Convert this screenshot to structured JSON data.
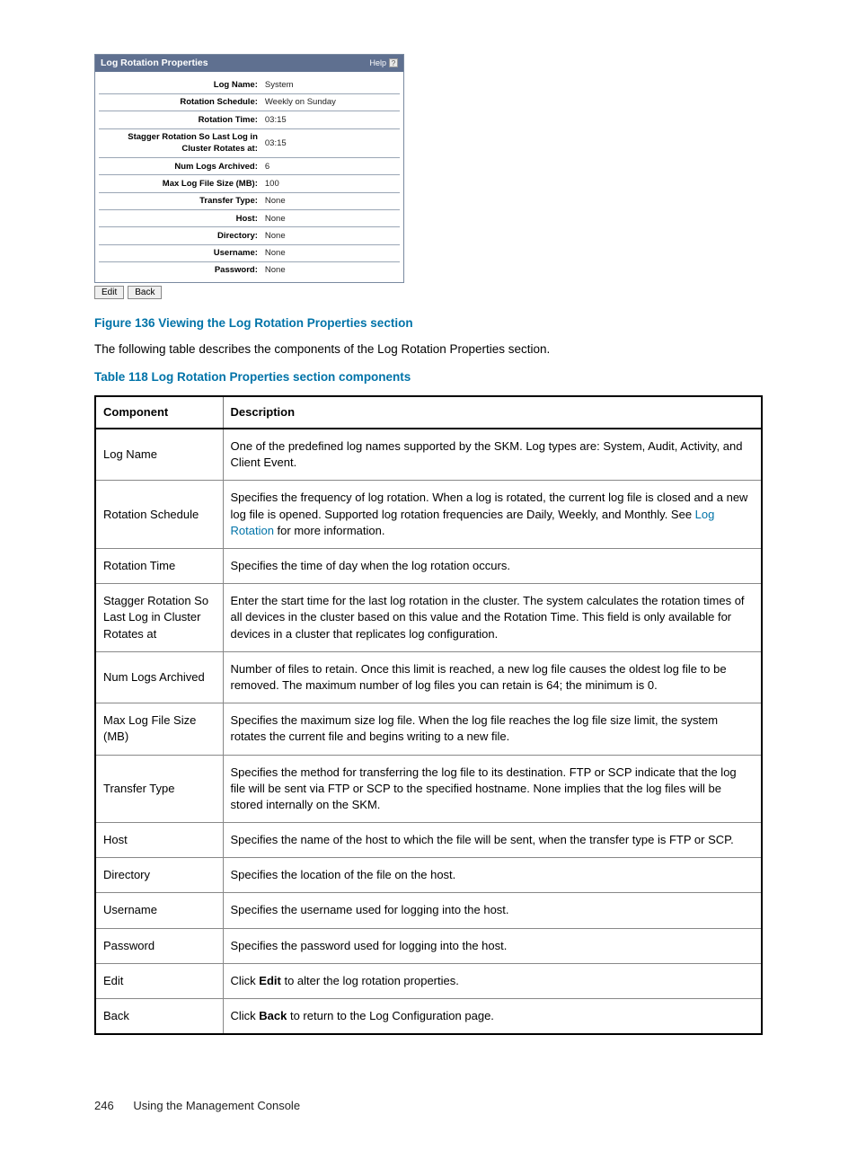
{
  "panel": {
    "title": "Log Rotation Properties",
    "help_label": "Help",
    "help_icon": "?",
    "rows": [
      {
        "label": "Log Name:",
        "value": "System"
      },
      {
        "label": "Rotation Schedule:",
        "value": "Weekly on Sunday"
      },
      {
        "label": "Rotation Time:",
        "value": "03:15"
      },
      {
        "label": "Stagger Rotation So Last Log in Cluster Rotates at:",
        "value": "03:15"
      },
      {
        "label": "Num Logs Archived:",
        "value": "6"
      },
      {
        "label": "Max Log File Size (MB):",
        "value": "100"
      },
      {
        "label": "Transfer Type:",
        "value": "None"
      },
      {
        "label": "Host:",
        "value": "None"
      },
      {
        "label": "Directory:",
        "value": "None"
      },
      {
        "label": "Username:",
        "value": "None"
      },
      {
        "label": "Password:",
        "value": "None"
      }
    ],
    "buttons": {
      "edit": "Edit",
      "back": "Back"
    }
  },
  "figure_caption": "Figure 136 Viewing the Log Rotation Properties section",
  "intro_text": "The following table describes the components of the Log Rotation Properties section.",
  "table_caption": "Table 118 Log Rotation Properties section components",
  "doc_table": {
    "head_component": "Component",
    "head_description": "Description",
    "rows": [
      {
        "component": "Log Name",
        "desc_pre": "One of the predefined log names supported by the SKM. Log types are: System, Audit, Activity, and Client Event.",
        "link": "",
        "desc_post": ""
      },
      {
        "component": "Rotation Schedule",
        "desc_pre": "Specifies the frequency of log rotation. When a log is rotated, the current log file is closed and a new log file is opened. Supported log rotation frequencies are Daily, Weekly, and Monthly. See ",
        "link": "Log Rotation",
        "desc_post": " for more information."
      },
      {
        "component": "Rotation Time",
        "desc_pre": "Specifies the time of day when the log rotation occurs.",
        "link": "",
        "desc_post": ""
      },
      {
        "component": "Stagger Rotation So Last Log in Cluster Rotates at",
        "desc_pre": "Enter the start time for the last log rotation in the cluster. The system calculates the rotation times of all devices in the cluster based on this value and the Rotation Time. This field is only available for devices in a cluster that replicates log configuration.",
        "link": "",
        "desc_post": ""
      },
      {
        "component": "Num Logs Archived",
        "desc_pre": "Number of files to retain. Once this limit is reached, a new log file causes the oldest log file to be removed. The maximum number of log files you can retain is 64; the minimum is 0.",
        "link": "",
        "desc_post": ""
      },
      {
        "component": "Max Log File Size (MB)",
        "desc_pre": "Specifies the maximum size log file. When the log file reaches the log file size limit, the system rotates the current file and begins writing to a new file.",
        "link": "",
        "desc_post": ""
      },
      {
        "component": "Transfer Type",
        "desc_pre": "Specifies the method for transferring the log file to its destination. FTP or SCP indicate that the log file will be sent via FTP or SCP to the specified hostname. None implies that the log files will be stored internally on the SKM.",
        "link": "",
        "desc_post": ""
      },
      {
        "component": "Host",
        "desc_pre": "Specifies the name of the host to which the file will be sent, when the transfer type is FTP or SCP.",
        "link": "",
        "desc_post": ""
      },
      {
        "component": "Directory",
        "desc_pre": "Specifies the location of the file on the host.",
        "link": "",
        "desc_post": ""
      },
      {
        "component": "Username",
        "desc_pre": "Specifies the username used for logging into the host.",
        "link": "",
        "desc_post": ""
      },
      {
        "component": "Password",
        "desc_pre": "Specifies the password used for logging into the host.",
        "link": "",
        "desc_post": ""
      },
      {
        "component": "Edit",
        "desc_pre": "Click ",
        "bold": "Edit",
        "desc_post": " to alter the log rotation properties."
      },
      {
        "component": "Back",
        "desc_pre": "Click ",
        "bold": "Back",
        "desc_post": " to return to the Log Configuration page."
      }
    ]
  },
  "footer": {
    "page": "246",
    "section": "Using the Management Console"
  }
}
